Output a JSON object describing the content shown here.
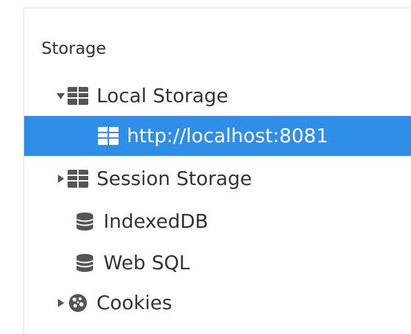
{
  "storage_panel": {
    "title": "Storage",
    "items": [
      {
        "label": "Local Storage",
        "expanded": true,
        "icon": "grid-table-icon",
        "arrow": "expanded-arrow-icon"
      },
      {
        "label": "http://localhost:8081",
        "selected": true,
        "icon": "grid-table-icon"
      },
      {
        "label": "Session Storage",
        "expanded": false,
        "icon": "grid-table-icon",
        "arrow": "collapsed-arrow-icon"
      },
      {
        "label": "IndexedDB",
        "icon": "database-icon"
      },
      {
        "label": "Web SQL",
        "icon": "database-icon"
      },
      {
        "label": "Cookies",
        "expanded": false,
        "icon": "cookie-icon",
        "arrow": "collapsed-arrow-icon"
      }
    ]
  },
  "colors": {
    "selection_background": "#2f8ee8",
    "selection_text": "#ffffff",
    "text": "#333333",
    "icon": "#555555",
    "divider": "#e0e0e0"
  }
}
